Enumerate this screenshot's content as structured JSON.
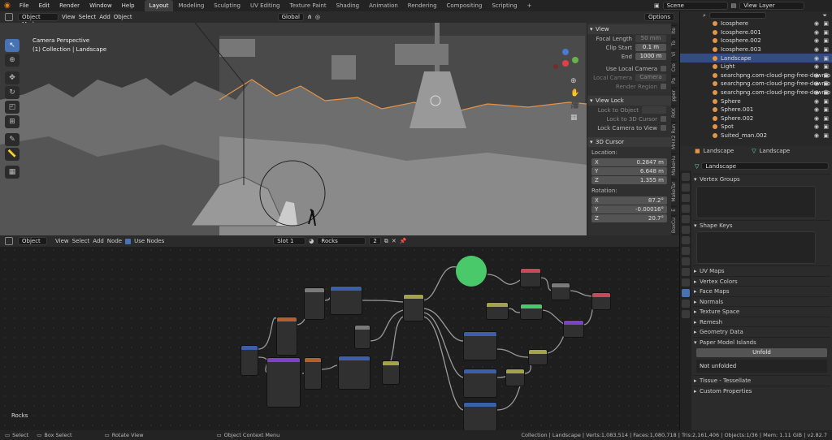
{
  "topbar": {
    "menus": [
      "File",
      "Edit",
      "Render",
      "Window",
      "Help"
    ],
    "workspaces": [
      "Layout",
      "Modeling",
      "Sculpting",
      "UV Editing",
      "Texture Paint",
      "Shading",
      "Animation",
      "Rendering",
      "Compositing",
      "Scripting"
    ],
    "active_workspace": "Layout",
    "scene": "Scene",
    "view_layer": "View Layer"
  },
  "viewport_header": {
    "mode": "Object Mode",
    "menus": [
      "View",
      "Select",
      "Add",
      "Object"
    ],
    "transform": "Global",
    "options": "Options"
  },
  "viewport": {
    "camera_label": "Camera Perspective",
    "collection_label": "(1) Collection | Landscape"
  },
  "npanel": {
    "view_title": "View",
    "focal_length_label": "Focal Length",
    "focal_length": "50 mm",
    "clip_start_label": "Clip Start",
    "clip_start": "0.1 m",
    "end_label": "End",
    "clip_end": "1000 m",
    "use_local_camera": "Use Local Camera",
    "local_camera_label": "Local Camera",
    "local_camera_value": "Camera",
    "render_region": "Render Region",
    "view_lock_title": "View Lock",
    "lock_to_object": "Lock to Object",
    "lock_to_3d_cursor": "Lock to 3D Cursor",
    "lock_camera_to_view": "Lock Camera to View",
    "cursor_title": "3D Cursor",
    "location_label": "Location:",
    "loc_x": "0.2847 m",
    "loc_y": "6.648 m",
    "loc_z": "1.355 m",
    "rotation_label": "Rotation:",
    "rot_x": "87.2°",
    "rot_y": "-0.00016°",
    "rot_z": "20.7°",
    "axis_x": "X",
    "axis_y": "Y",
    "axis_z": "Z",
    "tabs": [
      "Ite",
      "To",
      "Vi",
      "Cre",
      "Pa",
      "pper",
      "RKK",
      "MHX2 Run",
      "MakeHu",
      "MakeTar",
      "E",
      "BoxCu"
    ]
  },
  "outliner": {
    "items": [
      {
        "name": "Icosphere",
        "selected": false
      },
      {
        "name": "Icosphere.001",
        "selected": false
      },
      {
        "name": "Icosphere.002",
        "selected": false
      },
      {
        "name": "Icosphere.003",
        "selected": false
      },
      {
        "name": "Landscape",
        "selected": true
      },
      {
        "name": "Light",
        "selected": false
      },
      {
        "name": "searchpng.com-cloud-png-free-downlo",
        "selected": false
      },
      {
        "name": "searchpng.com-cloud-png-free-downlo",
        "selected": false
      },
      {
        "name": "searchpng.com-cloud-png-free-downlo",
        "selected": false
      },
      {
        "name": "Sphere",
        "selected": false
      },
      {
        "name": "Sphere.001",
        "selected": false
      },
      {
        "name": "Sphere.002",
        "selected": false
      },
      {
        "name": "Spot",
        "selected": false
      },
      {
        "name": "Suited_man.002",
        "selected": false
      }
    ]
  },
  "properties": {
    "object_name": "Landscape",
    "data_name": "Landscape",
    "datablock": "Landscape",
    "vertex_groups": "Vertex Groups",
    "shape_keys": "Shape Keys",
    "sections": [
      "UV Maps",
      "Vertex Colors",
      "Face Maps",
      "Normals",
      "Texture Space",
      "Remesh",
      "Geometry Data",
      "Paper Model Islands"
    ],
    "unfold": "Unfold",
    "not_unfolded": "Not unfolded",
    "tissue": "Tissue - Tessellate",
    "custom_props": "Custom Properties"
  },
  "node_header": {
    "type": "Object",
    "menus": [
      "View",
      "Select",
      "Add",
      "Node"
    ],
    "use_nodes": "Use Nodes",
    "slot": "Slot 1",
    "material": "Rocks",
    "users": "2"
  },
  "node_editor": {
    "material_label": "Rocks"
  },
  "status": {
    "select": "Select",
    "box_select": "Box Select",
    "rotate": "Rotate View",
    "context": "Object Context Menu",
    "stats": "Collection | Landscape | Verts:1,083,514 | Faces:1,080,718 | Tris:2,161,406 | Objects:1/36 | Mem: 1.11 GiB | v2.82.7"
  }
}
